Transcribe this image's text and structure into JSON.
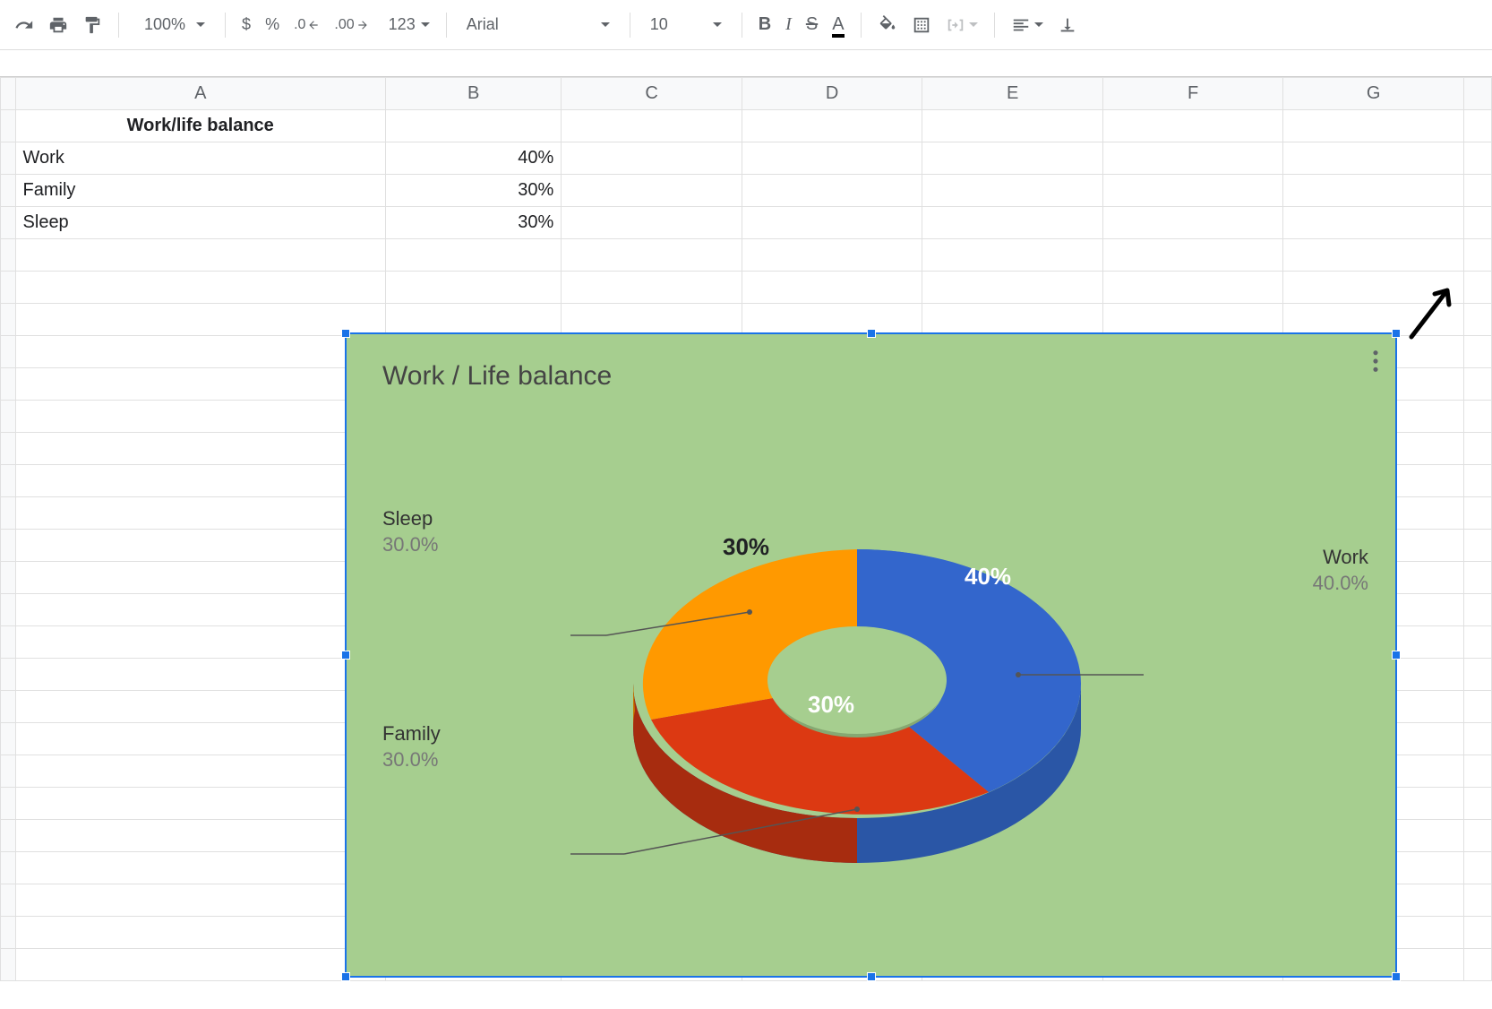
{
  "toolbar": {
    "zoom": "100%",
    "currency": "$",
    "percent": "%",
    "dec_dec": ".0",
    "dec_inc": ".00",
    "format_menu": "123",
    "font_name": "Arial",
    "font_size": "10"
  },
  "grid": {
    "columns": [
      "A",
      "B",
      "C",
      "D",
      "E",
      "F",
      "G"
    ],
    "rows": [
      {
        "a": "Work/life balance",
        "b": "",
        "bold": true
      },
      {
        "a": "Work",
        "b": "40%"
      },
      {
        "a": "Family",
        "b": "30%"
      },
      {
        "a": "Sleep",
        "b": "30%"
      }
    ]
  },
  "chart": {
    "title": "Work / Life balance",
    "labels": {
      "work": {
        "name": "Work",
        "pct": "40.0%"
      },
      "family": {
        "name": "Family",
        "pct": "30.0%"
      },
      "sleep": {
        "name": "Sleep",
        "pct": "30.0%"
      }
    },
    "inner": {
      "work": "40%",
      "family": "30%",
      "sleep": "30%"
    }
  },
  "chart_data": {
    "type": "pie",
    "title": "Work / Life balance",
    "categories": [
      "Work",
      "Family",
      "Sleep"
    ],
    "values": [
      40,
      30,
      30
    ],
    "colors": [
      "#3366cc",
      "#dc3912",
      "#ff9900"
    ],
    "donut": true,
    "three_d": true,
    "background": "#a6ce8f"
  }
}
